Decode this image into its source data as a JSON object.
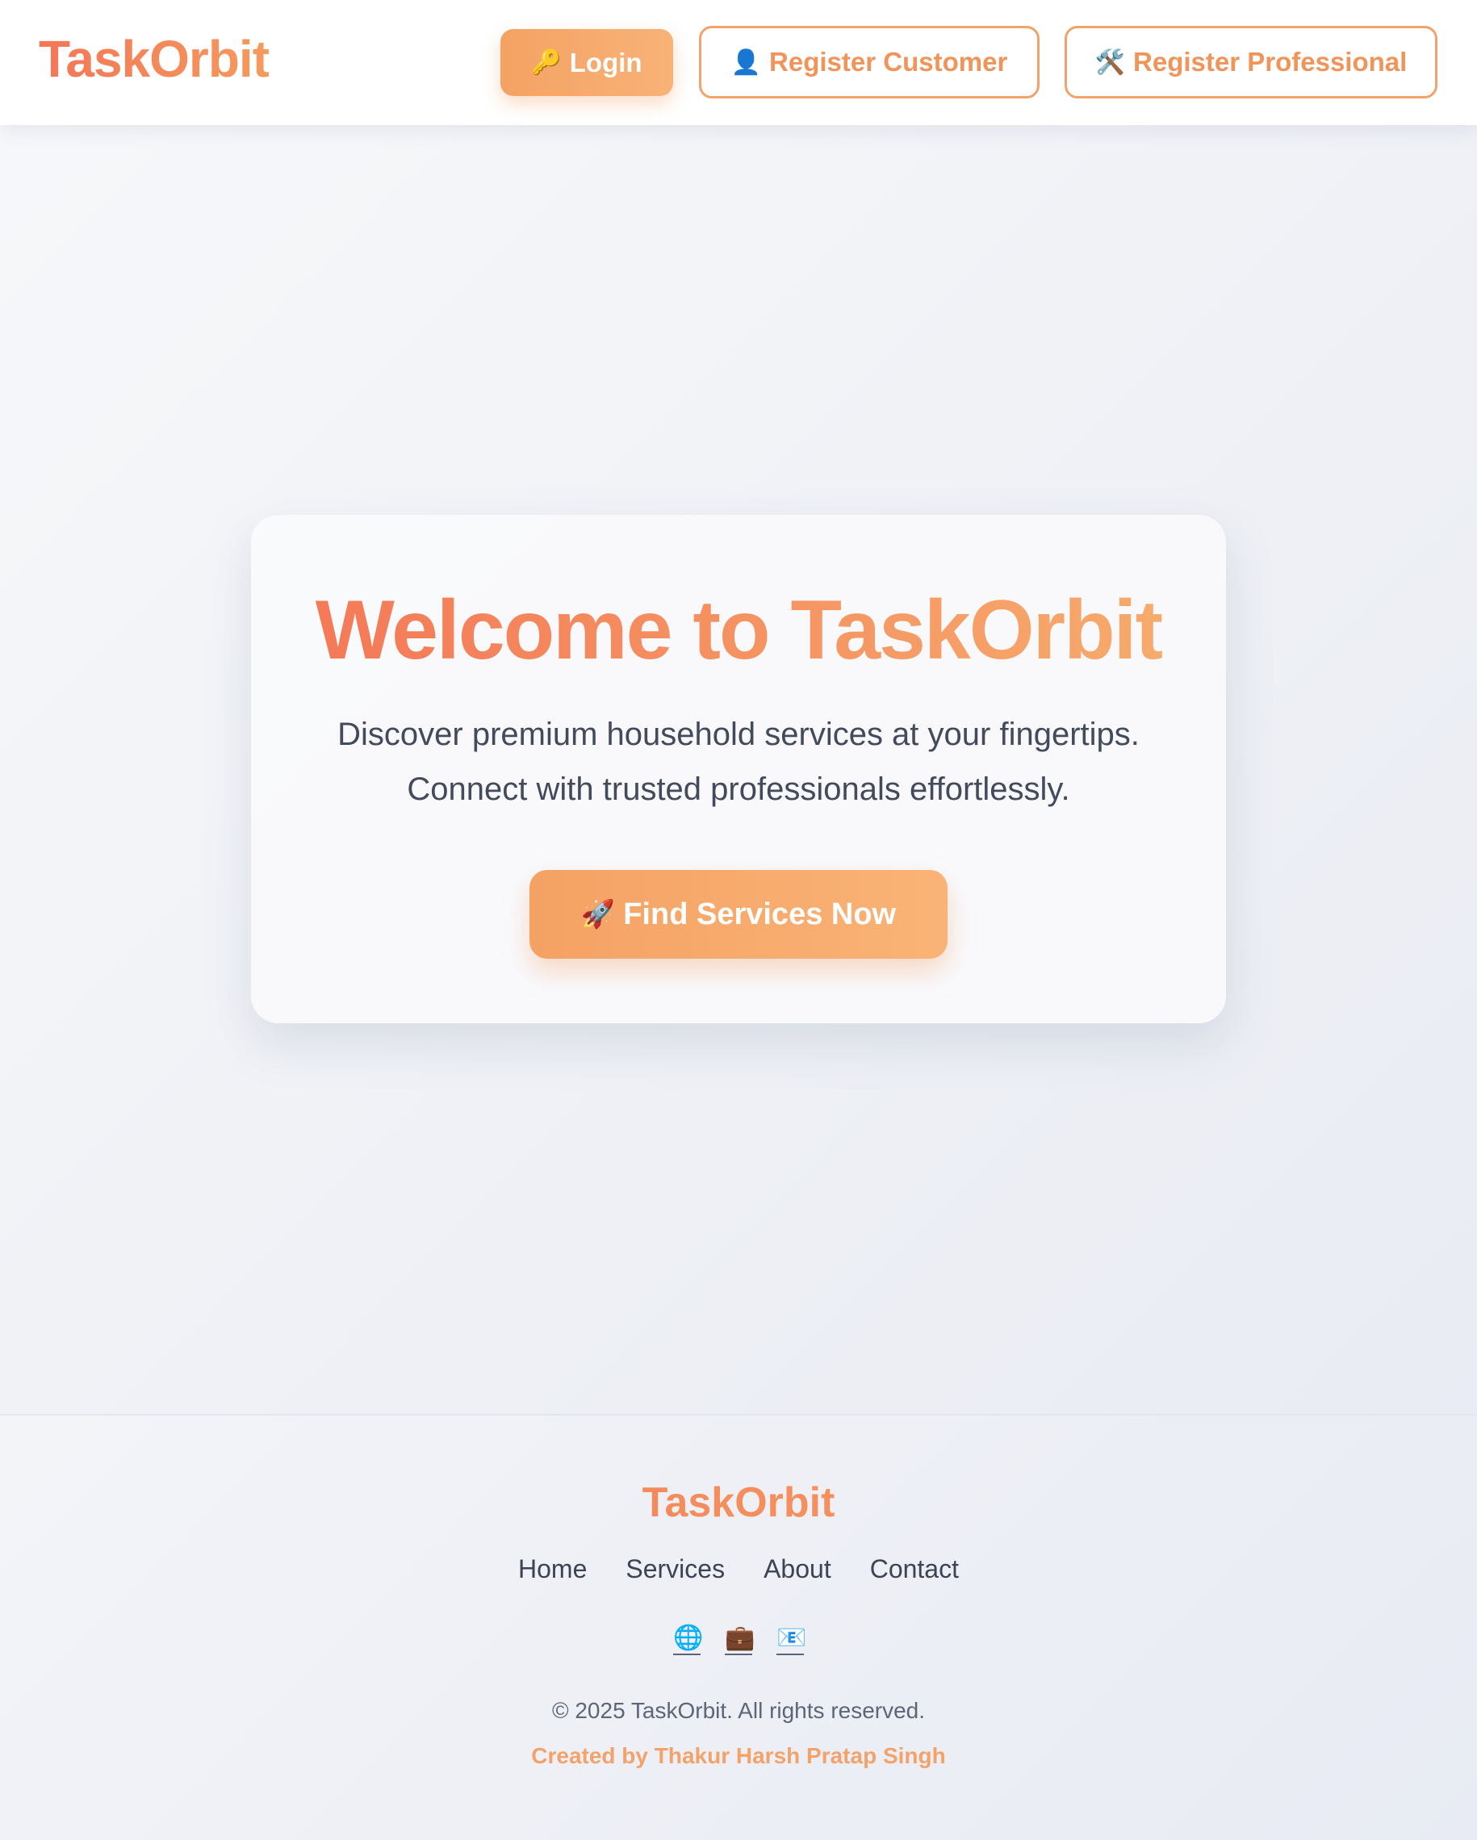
{
  "header": {
    "brand": "TaskOrbit",
    "login": {
      "icon": "🔑",
      "label": "Login"
    },
    "register_customer": {
      "icon": "👤",
      "label": "Register Customer"
    },
    "register_professional": {
      "icon": "🛠️",
      "label": "Register Professional"
    }
  },
  "hero": {
    "title": "Welcome to TaskOrbit",
    "subtitle_line1": "Discover premium household services at your fingertips.",
    "subtitle_line2": "Connect with trusted professionals effortlessly.",
    "cta": {
      "icon": "🚀",
      "label": "Find Services Now"
    }
  },
  "footer": {
    "brand": "TaskOrbit",
    "links": [
      "Home",
      "Services",
      "About",
      "Contact"
    ],
    "social_icons": [
      {
        "name": "globe-icon",
        "glyph": "🌐"
      },
      {
        "name": "briefcase-icon",
        "glyph": "💼"
      },
      {
        "name": "mail-icon",
        "glyph": "📧"
      }
    ],
    "copyright": "© 2025 TaskOrbit. All rights reserved.",
    "credit": "Created by Thakur Harsh Pratap Singh"
  },
  "colors": {
    "accent_orange": "#f4a264",
    "brand_gradient_start": "#f47656",
    "brand_gradient_end": "#f6ae6d",
    "text_dark": "#424a5c"
  }
}
